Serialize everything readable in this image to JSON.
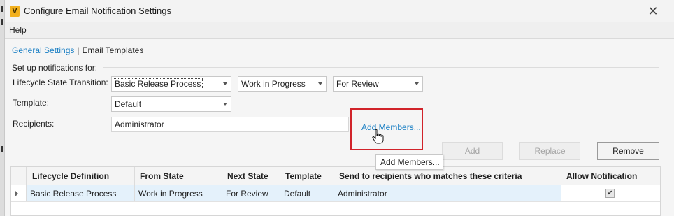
{
  "window": {
    "title": "Configure Email Notification Settings",
    "icon_letter": "V",
    "close_glyph": "✕"
  },
  "menu": {
    "help": "Help"
  },
  "tabs": {
    "general_settings": "General Settings",
    "separator": "|",
    "email_templates": "Email Templates"
  },
  "section": {
    "title": "Set up notifications for:"
  },
  "form": {
    "lifecycle_label": "Lifecycle State Transition:",
    "lifecycle_value": "Basic Release Process",
    "from_state_value": "Work in Progress",
    "to_state_value": "For Review",
    "template_label": "Template:",
    "template_value": "Default",
    "recipients_label": "Recipients:",
    "recipients_value": "Administrator",
    "add_members_link": "Add Members..."
  },
  "buttons": {
    "add": "Add",
    "replace": "Replace",
    "remove": "Remove"
  },
  "tooltip": {
    "text": "Add Members..."
  },
  "grid": {
    "columns": [
      "Lifecycle Definition",
      "From State",
      "Next State",
      "Template",
      "Send to recipients who matches these criteria",
      "Allow Notification"
    ],
    "rows": [
      {
        "lifecycle_definition": "Basic Release Process",
        "from_state": "Work in Progress",
        "next_state": "For Review",
        "template": "Default",
        "send_to": "Administrator",
        "allow_notification": true,
        "check_glyph": "✔"
      }
    ]
  },
  "colors": {
    "accent": "#1a7fc4",
    "highlight": "#d1232a",
    "selected_row": "#e4f1fb"
  }
}
